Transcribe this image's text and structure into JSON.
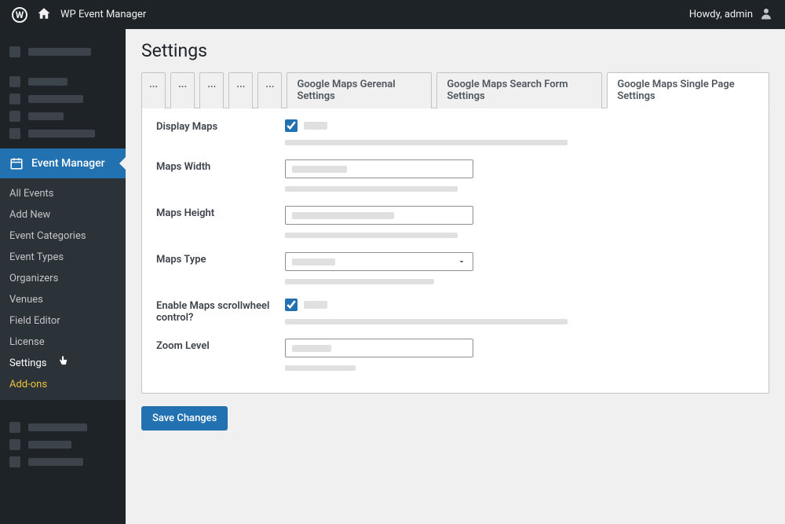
{
  "adminBar": {
    "siteTitle": "WP Event Manager",
    "greeting": "Howdy, admin"
  },
  "sidebar": {
    "activeLabel": "Event Manager",
    "submenu": [
      {
        "label": "All Events",
        "highlight": false
      },
      {
        "label": "Add New",
        "highlight": false
      },
      {
        "label": "Event Categories",
        "highlight": false
      },
      {
        "label": "Event Types",
        "highlight": false
      },
      {
        "label": "Organizers",
        "highlight": false
      },
      {
        "label": "Venues",
        "highlight": false
      },
      {
        "label": "Field Editor",
        "highlight": false
      },
      {
        "label": "License",
        "highlight": false
      },
      {
        "label": "Settings",
        "highlight": true
      },
      {
        "label": "Add-ons",
        "highlight": false,
        "addons": true
      }
    ]
  },
  "page": {
    "title": "Settings",
    "tabs": {
      "small": [
        "...",
        "...",
        "...",
        "...",
        "..."
      ],
      "named": [
        {
          "label": "Google Maps Gerenal Settings",
          "active": false
        },
        {
          "label": "Google Maps Search Form Settings",
          "active": false
        },
        {
          "label": "Google Maps Single Page Settings",
          "active": true
        }
      ]
    },
    "fields": {
      "displayMaps": {
        "label": "Display Maps",
        "checked": true
      },
      "mapsWidth": {
        "label": "Maps Width"
      },
      "mapsHeight": {
        "label": "Maps Height"
      },
      "mapsType": {
        "label": "Maps Type"
      },
      "scrollwheel": {
        "label": "Enable Maps scrollwheel control?",
        "checked": true
      },
      "zoomLevel": {
        "label": "Zoom Level"
      }
    },
    "saveButton": "Save Changes"
  }
}
